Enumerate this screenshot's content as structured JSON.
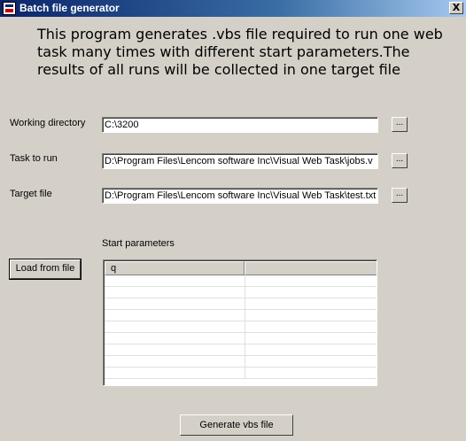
{
  "window": {
    "title": "Batch file generator",
    "close_label": "X"
  },
  "intro": "This program generates .vbs file required to run one web task many times with different start parameters.The results of all runs will be collected in one target file",
  "fields": {
    "working_directory": {
      "label": "Working directory",
      "value": "C:\\3200",
      "browse_label": "..."
    },
    "task_to_run": {
      "label": "Task to run",
      "value": "D:\\Program Files\\Lencom software Inc\\Visual Web Task\\jobs.v",
      "browse_label": "..."
    },
    "target_file": {
      "label": "Target file",
      "value": "D:\\Program Files\\Lencom software Inc\\Visual Web Task\\test.txt",
      "browse_label": "..."
    }
  },
  "start_parameters": {
    "label": "Start parameters",
    "columns": [
      "q",
      ""
    ],
    "rows": [
      [
        "",
        ""
      ],
      [
        "",
        ""
      ],
      [
        "",
        ""
      ],
      [
        "",
        ""
      ],
      [
        "",
        ""
      ],
      [
        "",
        ""
      ],
      [
        "",
        ""
      ],
      [
        "",
        ""
      ],
      [
        "",
        ""
      ]
    ]
  },
  "buttons": {
    "load_from_file": "Load from file",
    "generate": "Generate vbs file"
  }
}
